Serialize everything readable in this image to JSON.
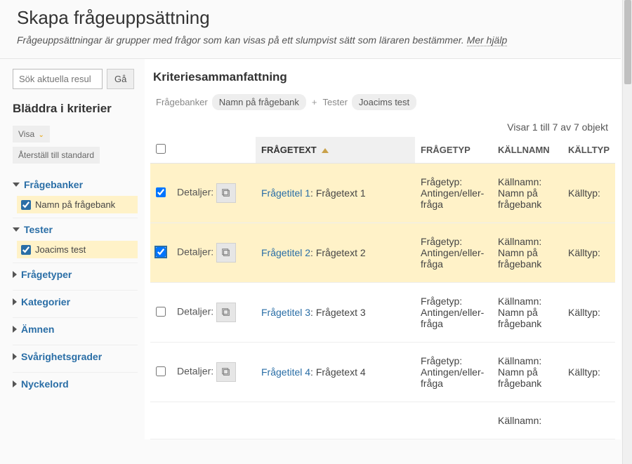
{
  "header": {
    "title": "Skapa frågeuppsättning",
    "description": "Frågeuppsättningar är grupper med frågor som kan visas på ett slumpvist sätt som läraren bestämmer.",
    "help_link": "Mer hjälp"
  },
  "sidebar": {
    "search_placeholder": "Sök aktuella resul",
    "go_label": "Gå",
    "browse_title": "Bläddra i kriterier",
    "show_label": "Visa",
    "reset_label": "Återställ till standard",
    "categories": [
      {
        "label": "Frågebanker",
        "expanded": true,
        "items": [
          {
            "label": "Namn på frågebank",
            "checked": true
          }
        ]
      },
      {
        "label": "Tester",
        "expanded": true,
        "items": [
          {
            "label": "Joacims test",
            "checked": true
          }
        ]
      },
      {
        "label": "Frågetyper",
        "expanded": false
      },
      {
        "label": "Kategorier",
        "expanded": false
      },
      {
        "label": "Ämnen",
        "expanded": false
      },
      {
        "label": "Svårighetsgrader",
        "expanded": false
      },
      {
        "label": "Nyckelord",
        "expanded": false
      }
    ]
  },
  "content": {
    "summary_title": "Kriteriesammanfattning",
    "crumbs": {
      "banks_label": "Frågebanker",
      "bank_value": "Namn på frågebank",
      "tests_label": "Tester",
      "test_value": "Joacims test"
    },
    "count_text": "Visar 1 till 7 av 7 objekt",
    "columns": {
      "text": "FRÅGETEXT",
      "type": "FRÅGETYP",
      "src": "KÄLLNAMN",
      "srctype": "KÄLLTYP"
    },
    "details_label": "Detaljer:",
    "rows": [
      {
        "checked": true,
        "selected": true,
        "title": "Frågetitel 1",
        "text": "Frågetext 1",
        "type": "Frågetyp: Antingen/eller-fråga",
        "src": "Källnamn: Namn på frågebank",
        "srctype": "Källtyp:"
      },
      {
        "checked": true,
        "selected": true,
        "focus": true,
        "title": "Frågetitel 2",
        "text": "Frågetext 2",
        "type": "Frågetyp: Antingen/eller-fråga",
        "src": "Källnamn: Namn på frågebank",
        "srctype": "Källtyp:"
      },
      {
        "checked": false,
        "selected": false,
        "title": "Frågetitel 3",
        "text": "Frågetext 3",
        "type": "Frågetyp: Antingen/eller-fråga",
        "src": "Källnamn: Namn på frågebank",
        "srctype": "Källtyp:"
      },
      {
        "checked": false,
        "selected": false,
        "title": "Frågetitel 4",
        "text": "Frågetext 4",
        "type": "Frågetyp: Antingen/eller-fråga",
        "src": "Källnamn: Namn på frågebank",
        "srctype": "Källtyp:"
      }
    ],
    "partial_src": "Källnamn:"
  }
}
